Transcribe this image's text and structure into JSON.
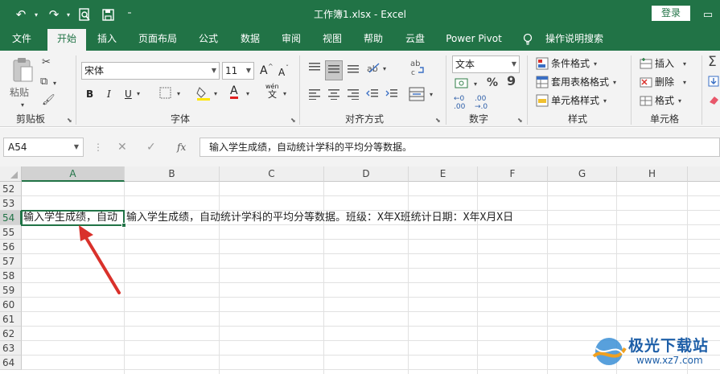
{
  "titlebar": {
    "title": "工作簿1.xlsx  -  Excel",
    "login_label": "登录",
    "qa": {
      "undo": "↶",
      "redo": "↷",
      "preview": "🔍",
      "save": "💾",
      "customize": "⊤"
    }
  },
  "menubar": {
    "tabs": [
      "文件",
      "开始",
      "插入",
      "页面布局",
      "公式",
      "数据",
      "审阅",
      "视图",
      "帮助",
      "云盘",
      "Power Pivot",
      "操作说明搜索"
    ],
    "active": "开始"
  },
  "ribbon": {
    "clipboard": {
      "paste_label": "粘贴",
      "group_label": "剪贴板"
    },
    "font": {
      "font_name": "宋体",
      "font_size": "11",
      "grow": "A",
      "shrink": "A",
      "bold": "B",
      "italic": "I",
      "underline": "U",
      "font_color_letter": "A",
      "wen": "wén",
      "wen2": "文",
      "group_label": "字体"
    },
    "alignment": {
      "group_label": "对齐方式"
    },
    "number": {
      "format": "文本",
      "percent": "%",
      "comma": "9",
      "group_label": "数字"
    },
    "styles": {
      "cond_format": "条件格式",
      "table_format": "套用表格格式",
      "cell_style": "单元格样式",
      "group_label": "样式"
    },
    "cells": {
      "insert": "插入",
      "delete": "删除",
      "format": "格式",
      "group_label": "单元格"
    }
  },
  "formula_bar": {
    "name_box": "A54",
    "fx": "fx",
    "content": "输入学生成绩，自动统计学科的平均分等数据。"
  },
  "sheet": {
    "columns": [
      "A",
      "B",
      "C",
      "D",
      "E",
      "F",
      "G",
      "H"
    ],
    "rows": [
      "52",
      "53",
      "54",
      "55",
      "56",
      "57",
      "58",
      "59",
      "60",
      "61",
      "62",
      "63",
      "64"
    ],
    "selected_cell": "A54",
    "a54_visible": "输入学生成绩，自动",
    "b54_text": "输入学生成绩，自动统计学科的平均分等数据。班级：X年X班统计日期：X年X月X日"
  },
  "watermark": {
    "text": "极光下载站",
    "url": "www.xz7.com"
  },
  "colors": {
    "accent": "#217346",
    "arrow": "#d9312b"
  }
}
